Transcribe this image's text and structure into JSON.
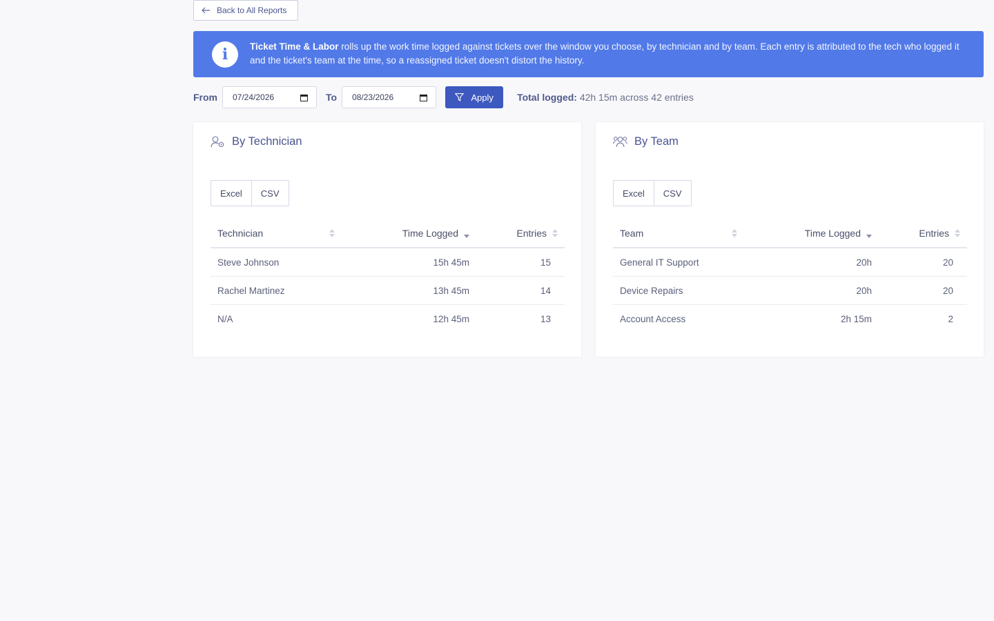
{
  "back_button": {
    "label": "Back to All Reports",
    "icon": "arrow-left-icon"
  },
  "banner": {
    "title": "Ticket Time & Labor",
    "text": "rolls up the work time logged against tickets over the window you choose, by technician and by team. Each entry is attributed to the tech who logged it and the ticket's team at the time, so a reassigned ticket doesn't distort the history.",
    "icon": "info-icon"
  },
  "filters": {
    "from_label": "From",
    "from_value": "07/24/2026",
    "to_label": "To",
    "to_value": "08/23/2026",
    "apply_label": "Apply",
    "total_label": "Total logged:",
    "total_value": "42h 15m across 42 entries"
  },
  "by_technician": {
    "title": "By Technician",
    "export": {
      "excel": "Excel",
      "csv": "CSV"
    },
    "headers": {
      "name": "Technician",
      "time": "Time Logged",
      "entries": "Entries"
    },
    "rows": [
      {
        "name": "Steve Johnson",
        "time": "15h 45m",
        "entries": "15"
      },
      {
        "name": "Rachel Martinez",
        "time": "13h 45m",
        "entries": "14"
      },
      {
        "name": "N/A",
        "time": "12h 45m",
        "entries": "13"
      }
    ]
  },
  "by_team": {
    "title": "By Team",
    "export": {
      "excel": "Excel",
      "csv": "CSV"
    },
    "headers": {
      "name": "Team",
      "time": "Time Logged",
      "entries": "Entries"
    },
    "rows": [
      {
        "name": "General IT Support",
        "time": "20h",
        "entries": "20"
      },
      {
        "name": "Device Repairs",
        "time": "20h",
        "entries": "20"
      },
      {
        "name": "Account Access",
        "time": "2h 15m",
        "entries": "2"
      }
    ]
  },
  "colors": {
    "accent": "#5179e8",
    "primary_button": "#3d58bf",
    "background": "#f8f8fb"
  }
}
